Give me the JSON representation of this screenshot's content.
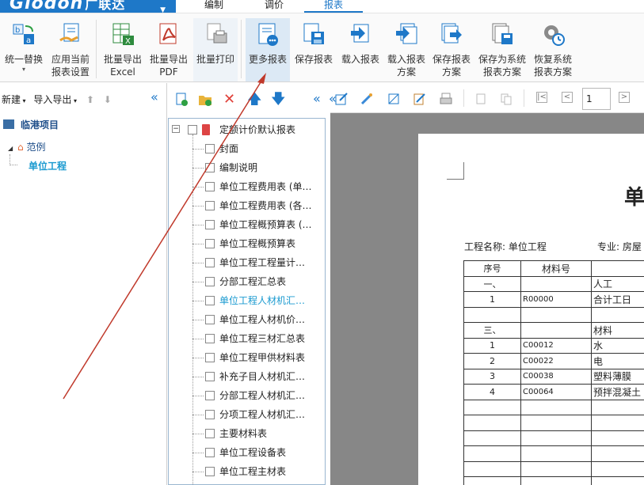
{
  "app": {
    "logo_text": "Glodon",
    "logo_cn": "广联达",
    "menu_tabs": [
      "编制",
      "调价",
      "报表"
    ],
    "active_tab": "报表"
  },
  "ribbon": {
    "buttons": [
      {
        "line1": "统一替换",
        "line2": "▾"
      },
      {
        "line1": "应用当前",
        "line2": "报表设置"
      },
      {
        "line1": "批量导出",
        "line2": "Excel"
      },
      {
        "line1": "批量导出",
        "line2": "PDF"
      },
      {
        "line1": "批量打印",
        "line2": ""
      },
      {
        "line1": "更多报表",
        "line2": ""
      },
      {
        "line1": "保存报表",
        "line2": ""
      },
      {
        "line1": "载入报表",
        "line2": ""
      },
      {
        "line1": "载入报表",
        "line2": "方案"
      },
      {
        "line1": "保存报表",
        "line2": "方案"
      },
      {
        "line1": "保存为系统",
        "line2": "报表方案"
      },
      {
        "line1": "恢复系统",
        "line2": "报表方案"
      }
    ]
  },
  "left": {
    "new_label": "新建",
    "import_export_label": "导入导出",
    "project": "临港项目",
    "example": "范例",
    "unit": "单位工程"
  },
  "reports": {
    "group": "定额计价默认报表",
    "items": [
      "封面",
      "编制说明",
      "单位工程费用表 (单…",
      "单位工程费用表 (各…",
      "单位工程概预算表 (…",
      "单位工程概预算表",
      "单位工程工程量计…",
      "分部工程汇总表",
      "单位工程人材机汇…",
      "单位工程人材机价…",
      "单位工程三材汇总表",
      "单位工程甲供材料表",
      "补充子目人材机汇…",
      "分部工程人材机汇…",
      "分项工程人材机汇…",
      "主要材料表",
      "单位工程设备表",
      "单位工程主材表"
    ],
    "highlighted_index": 8
  },
  "preview": {
    "page_number": "1",
    "title_char": "单",
    "project_label": "工程名称: 单位工程",
    "major_label": "专业: 房屋",
    "headers": [
      "序号",
      "材料号",
      ""
    ],
    "rows": [
      [
        "一、",
        "",
        "人工"
      ],
      [
        "1",
        "R00000",
        "合计工日"
      ],
      [
        "",
        "",
        ""
      ],
      [
        "三、",
        "",
        "材料"
      ],
      [
        "1",
        "C00012",
        "水"
      ],
      [
        "2",
        "C00022",
        "电"
      ],
      [
        "3",
        "C00038",
        "塑料薄膜"
      ],
      [
        "4",
        "C00064",
        "预拌混凝土"
      ],
      [
        "",
        "",
        ""
      ],
      [
        "",
        "",
        ""
      ],
      [
        "",
        "",
        ""
      ],
      [
        "",
        "",
        ""
      ],
      [
        "",
        "",
        ""
      ],
      [
        "",
        "",
        ""
      ]
    ]
  },
  "colors": {
    "accent": "#1e78c8",
    "highlight_text": "#1a9ad0",
    "preview_bg": "#878787",
    "annotation_arrow": "#c0392b"
  }
}
